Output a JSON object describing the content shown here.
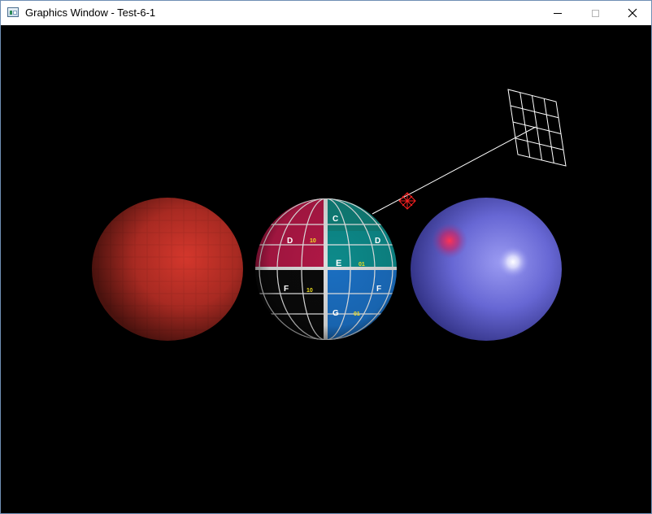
{
  "window": {
    "title": "Graphics Window - Test-6-1",
    "icon": "app-window-icon",
    "controls": [
      "minimize-icon",
      "maximize-icon",
      "close-icon"
    ]
  },
  "scene": {
    "background": "#000000",
    "objects": [
      {
        "name": "flat-shaded-red-sphere",
        "color": "#c93026"
      },
      {
        "name": "textured-sphere",
        "texture_labels": [
          "C",
          "D",
          "10",
          "D",
          "E",
          "01",
          "F",
          "10",
          "F",
          "G",
          "01"
        ]
      },
      {
        "name": "smooth-shaded-blue-sphere",
        "color": "#6a6ad8",
        "highlight_colors": [
          "#e0305a",
          "#ffffff"
        ]
      },
      {
        "name": "wireframe-grid-plane",
        "color": "#ffffff"
      },
      {
        "name": "light-marker",
        "color": "#ff0000"
      }
    ],
    "texture_colors": {
      "top_left": "#b01846",
      "top_right": "#0d8a8a",
      "bottom_left": "#0a0a0a",
      "bottom_right": "#1b6fc2",
      "grid": "#e8e8e8",
      "label": "#f0e020"
    }
  }
}
